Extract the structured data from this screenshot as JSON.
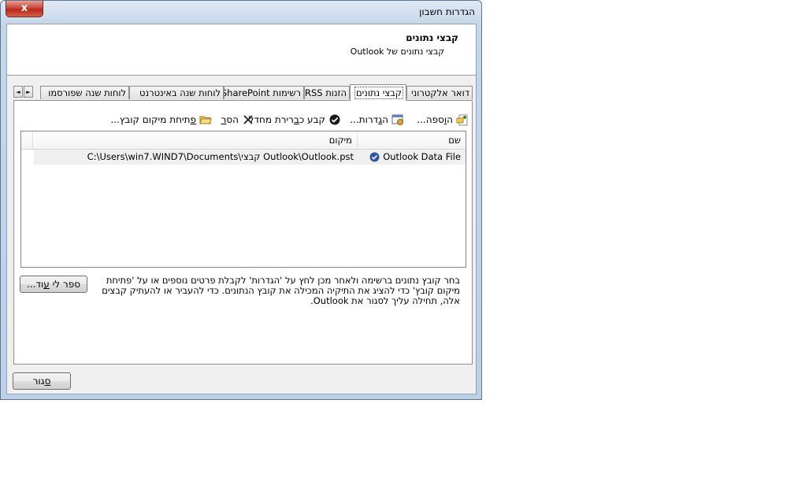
{
  "window": {
    "title": "הגדרות חשבון",
    "close_glyph": "x"
  },
  "header": {
    "title": "קבצי נתונים",
    "subtitle": "קבצי נתונים של Outlook"
  },
  "tabs": [
    {
      "label": "דואר אלקטרוני"
    },
    {
      "label": "קבצי נתונים"
    },
    {
      "label": "הזנות RSS"
    },
    {
      "label": "רשימות SharePoint"
    },
    {
      "label": "לוחות שנה באינטרנט"
    },
    {
      "label": "לוחות שנה שפורסמו"
    }
  ],
  "tab_scroll": {
    "left": "◄",
    "right": "►"
  },
  "toolbar": {
    "add": {
      "pre": "ה",
      "key": "ו",
      "post": "ספה..."
    },
    "settings": {
      "pre": "ה",
      "key": "ג",
      "post": "דרות..."
    },
    "default": {
      "pre": "קבע כ",
      "key": "ב",
      "post": "רירת מחדל"
    },
    "remove": {
      "pre": "הס",
      "key": "ר",
      "post": ""
    },
    "open_location": {
      "pre": "",
      "key": "פ",
      "post": "תיחת מיקום קובץ..."
    }
  },
  "list": {
    "columns": {
      "name": "שם",
      "location": "מיקום"
    },
    "rows": [
      {
        "name": "Outlook Data File",
        "location": "C:\\Users\\win7.WIND7\\Documents\\קבצי Outlook\\Outlook.pst"
      }
    ]
  },
  "info_text": "בחר קובץ נתונים ברשימה ולאחר מכן לחץ על 'הגדרות' לקבלת פרטים נוספים או על 'פתיחת מיקום קובץ' כדי להציג את התיקיה המכילה את קובץ הנתונים. כדי להעביר או להעתיק קבצים אלה, תחילה עליך לסגור את Outlook.",
  "buttons": {
    "tell_more": {
      "pre": "ספר לי ",
      "key": "ע",
      "post": "וד..."
    },
    "close": {
      "pre": "",
      "key": "ס",
      "post": "גור"
    }
  }
}
